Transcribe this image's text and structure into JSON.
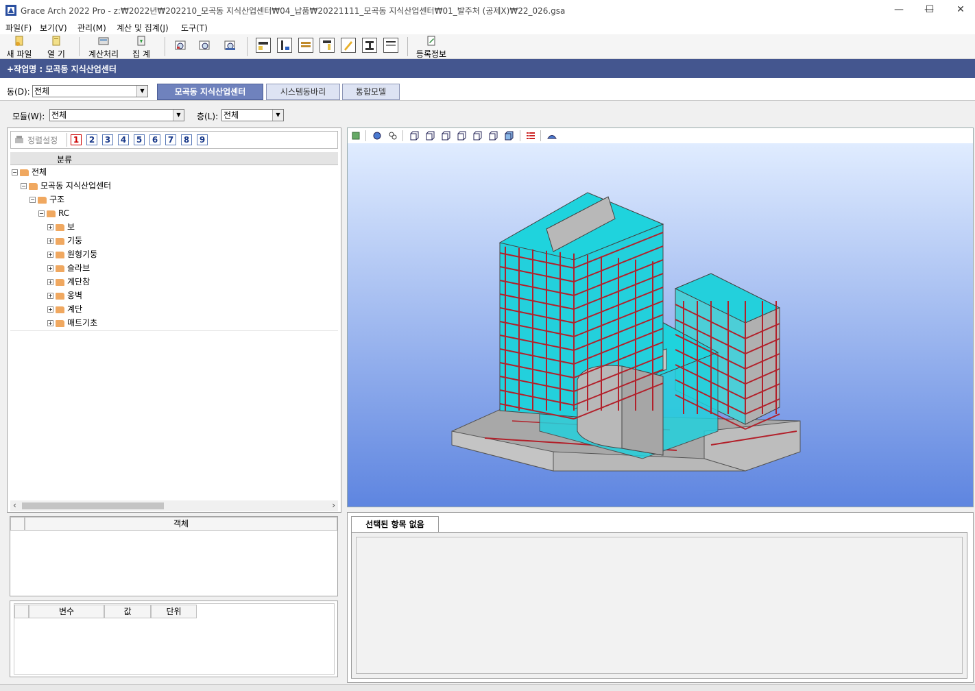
{
  "window": {
    "title": "Grace Arch 2022 Pro - z:₩2022년₩202210_모곡동 지식산업센터₩04_납품₩20221111_모곡동 지식산업센터₩01_발주처 (공제X)₩22_026.gsa",
    "minimize": "—",
    "maximize": "☐",
    "close": "✕"
  },
  "menu": [
    "파일(F)",
    "보기(V)",
    "관리(M)",
    "계산 및 집계(J)",
    "도구(T)"
  ],
  "toolbar": {
    "new_file": "새 파일",
    "open": "열  기",
    "calculate": "계산처리",
    "aggregate": "집  계",
    "register_info": "등록정보"
  },
  "project_header": "+작업명 : 모곡동 지식산업센터",
  "building": {
    "label": "동(D):",
    "value": "전체"
  },
  "tabs": [
    "모곡동 지식산업센터",
    "시스템동바리",
    "통합모델"
  ],
  "active_tab": 0,
  "module": {
    "label": "모듈(W):",
    "value": "전체"
  },
  "floor": {
    "label": "층(L):",
    "value": "전체"
  },
  "sort_setting": "정렬설정",
  "number_buttons": [
    "1",
    "2",
    "3",
    "4",
    "5",
    "6",
    "7",
    "8",
    "9"
  ],
  "tree": {
    "header": "분류",
    "items": [
      {
        "label": "전체",
        "level": 0,
        "exp": "−"
      },
      {
        "label": "모곡동 지식산업센터",
        "level": 1,
        "exp": "−"
      },
      {
        "label": "구조",
        "level": 2,
        "exp": "−"
      },
      {
        "label": "RC",
        "level": 3,
        "exp": "−"
      },
      {
        "label": "보",
        "level": 4,
        "exp": "+"
      },
      {
        "label": "기둥",
        "level": 4,
        "exp": "+"
      },
      {
        "label": "원형기둥",
        "level": 4,
        "exp": "+"
      },
      {
        "label": "슬라브",
        "level": 4,
        "exp": "+"
      },
      {
        "label": "계단참",
        "level": 4,
        "exp": "+"
      },
      {
        "label": "옹벽",
        "level": 4,
        "exp": "+"
      },
      {
        "label": "계단",
        "level": 4,
        "exp": "+"
      },
      {
        "label": "매트기초",
        "level": 4,
        "exp": "+"
      }
    ]
  },
  "object_panel": {
    "header": "객체"
  },
  "variables_panel": {
    "col_variable": "변수",
    "col_value": "값",
    "col_unit": "단위"
  },
  "details": {
    "tab": "선택된 항목 없음"
  },
  "colors": {
    "header_bg": "#44568f",
    "tab_active": "#6f82bd",
    "slab": "#1fd3dd",
    "beam": "#b2202a",
    "concrete": "#b8b8b8"
  }
}
